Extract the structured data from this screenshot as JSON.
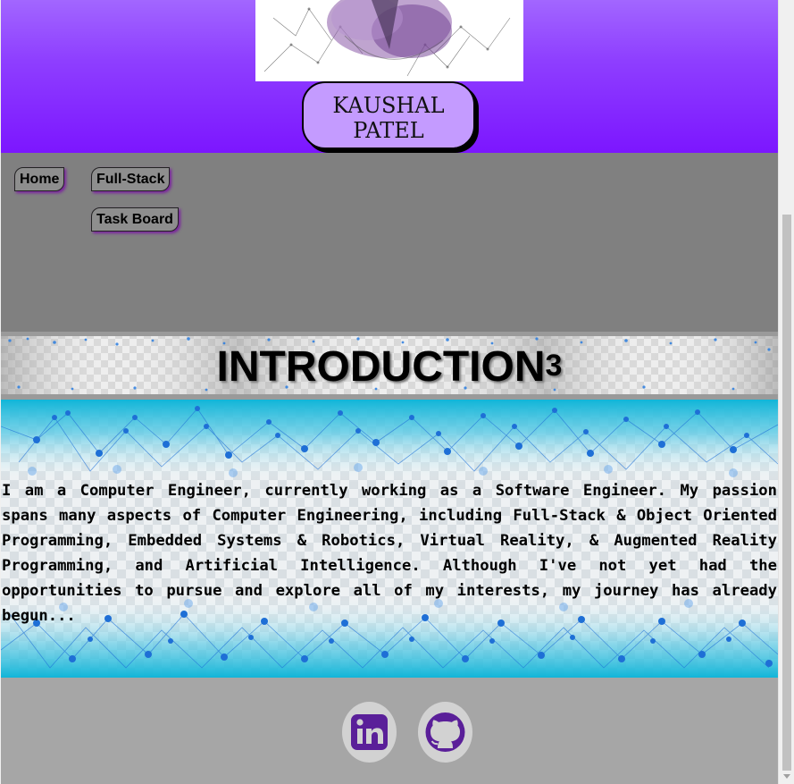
{
  "header": {
    "name_line1": "KAUSHAL",
    "name_line2": "PATEL"
  },
  "nav": {
    "items": [
      {
        "label": "Home"
      },
      {
        "label": "Full-Stack"
      },
      {
        "label": "Task Board"
      }
    ]
  },
  "intro": {
    "title": "INTRODUCTION",
    "superscript": "3",
    "body": "I am a Computer Engineer, currently working as a Software Engineer. My passion spans many aspects of Computer Engineering, including Full-Stack & Object Oriented Programming, Embedded Systems & Robotics, Virtual Reality, & Augmented Reality Programming, and Artificial Intelligence. Although I've not yet had the opportunities to pursue and explore all of my interests, my journey has already begun..."
  },
  "footer": {
    "links": [
      {
        "icon": "linkedin-icon"
      },
      {
        "icon": "github-icon"
      }
    ]
  },
  "colors": {
    "header_gradient_top": "#a266ff",
    "header_gradient_bottom": "#7c16ff",
    "name_pill": "#c49bff",
    "nav_bg": "#808080",
    "footer_bg": "#a6a6a6",
    "icon_purple": "#5a1f99"
  }
}
